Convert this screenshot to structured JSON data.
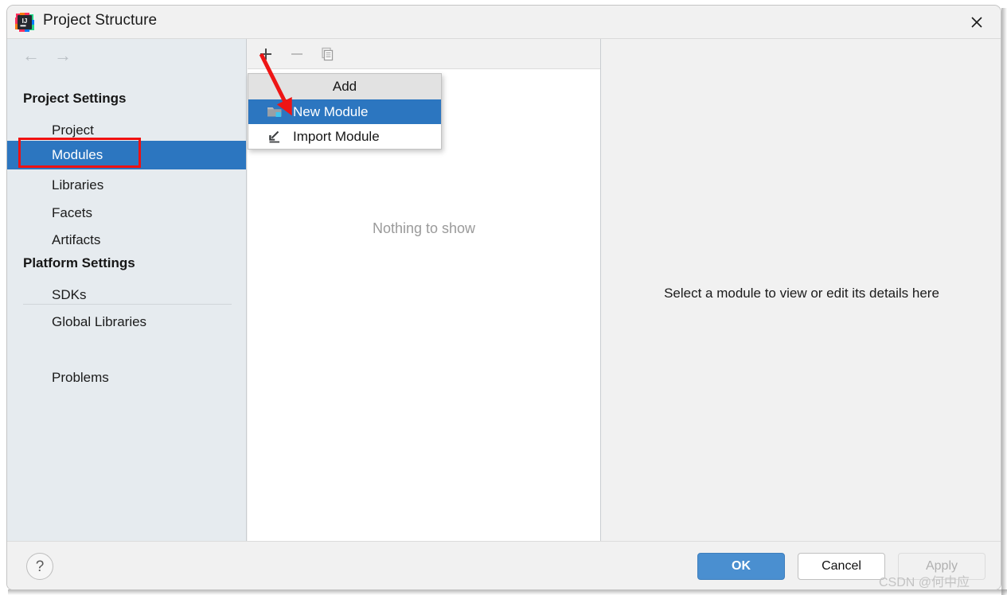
{
  "window": {
    "title": "Project Structure",
    "app_icon": "intellij-idea-icon",
    "close_icon": "close-icon"
  },
  "sidebar": {
    "nav": {
      "back_icon": "arrow-left-icon",
      "forward_icon": "arrow-right-icon"
    },
    "groups": [
      {
        "label": "Project Settings",
        "items": [
          {
            "label": "Project",
            "selected": false
          },
          {
            "label": "Modules",
            "selected": true
          },
          {
            "label": "Libraries",
            "selected": false
          },
          {
            "label": "Facets",
            "selected": false
          },
          {
            "label": "Artifacts",
            "selected": false
          }
        ]
      },
      {
        "label": "Platform Settings",
        "items": [
          {
            "label": "SDKs",
            "selected": false
          },
          {
            "label": "Global Libraries",
            "selected": false
          }
        ]
      }
    ],
    "extra_items": [
      {
        "label": "Problems",
        "selected": false
      }
    ]
  },
  "middle_panel": {
    "toolbar": {
      "add_icon": "plus-icon",
      "remove_icon": "minus-icon",
      "copy_icon": "copy-icon"
    },
    "empty_text": "Nothing to show"
  },
  "right_panel": {
    "hint_text": "Select a module to view or edit its details here"
  },
  "popup_menu": {
    "header": "Add",
    "items": [
      {
        "label": "New Module",
        "icon": "new-folder-icon",
        "selected": true
      },
      {
        "label": "Import Module",
        "icon": "import-arrow-icon",
        "selected": false
      }
    ]
  },
  "footer": {
    "help_label": "?",
    "ok_label": "OK",
    "cancel_label": "Cancel",
    "apply_label": "Apply"
  },
  "watermark": {
    "text": "CSDN @何中应"
  },
  "annotations": {
    "highlight_target": "Modules",
    "arrow_points_to": "New Module",
    "accent_color": "#2c76c0",
    "annotation_color": "#ef1111"
  }
}
